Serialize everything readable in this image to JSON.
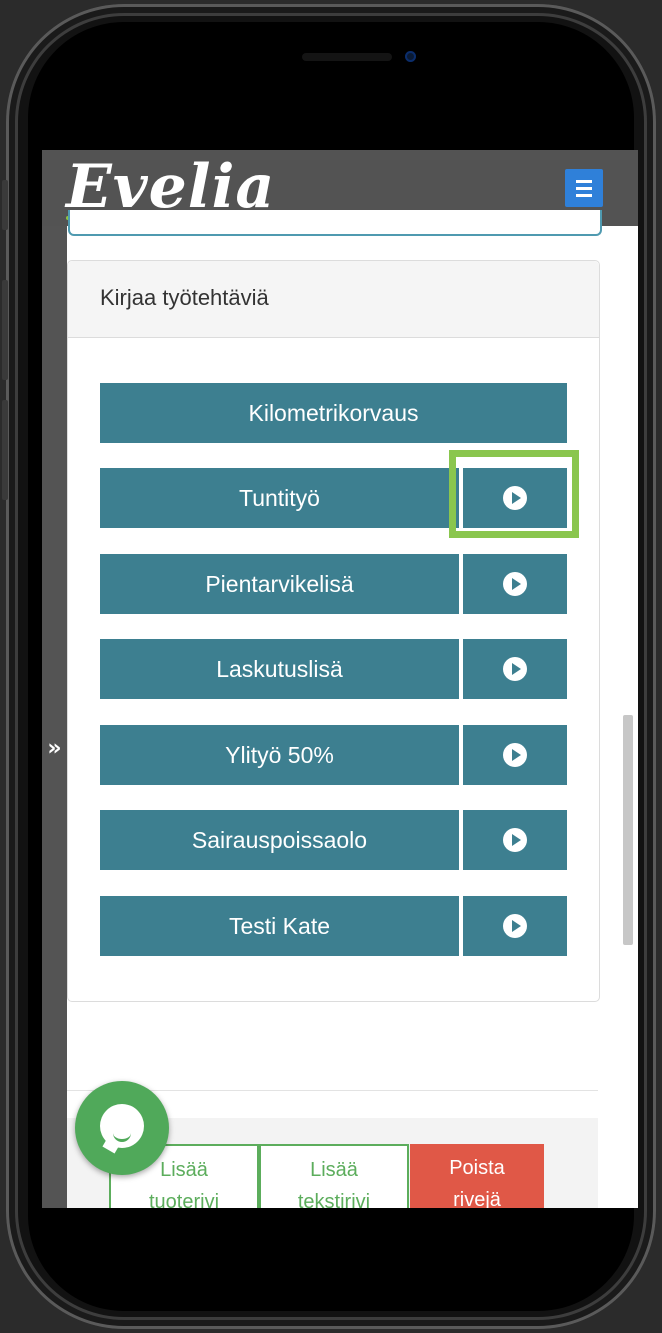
{
  "app": {
    "logo": "Evelia"
  },
  "nav": {
    "menu_icon": "hamburger-icon",
    "expand_icon": "double-chevron-right-icon",
    "expand_glyph": "»"
  },
  "card": {
    "title": "Kirjaa työtehtäviä",
    "tasks": [
      {
        "label": "Kilometrikorvaus",
        "has_play": false
      },
      {
        "label": "Tuntityö",
        "has_play": true
      },
      {
        "label": "Pientarvikelisä",
        "has_play": true
      },
      {
        "label": "Laskutuslisä",
        "has_play": true
      },
      {
        "label": "Ylityö 50%",
        "has_play": true
      },
      {
        "label": "Sairauspoissaolo",
        "has_play": true
      },
      {
        "label": "Testi Kate",
        "has_play": true
      }
    ]
  },
  "actions": {
    "add_product_row": [
      "Lisää",
      "tuoterivi"
    ],
    "add_text_row": [
      "Lisää",
      "tekstirivi"
    ],
    "delete_rows": [
      "Poista",
      "rivejä"
    ]
  },
  "colors": {
    "task_button": "#3d7f90",
    "highlight": "#8ac64e",
    "menu_button": "#2f80d9",
    "chat_bubble": "#50a95a",
    "danger": "#e05847"
  },
  "chat": {
    "icon": "chat-bubble-icon"
  }
}
